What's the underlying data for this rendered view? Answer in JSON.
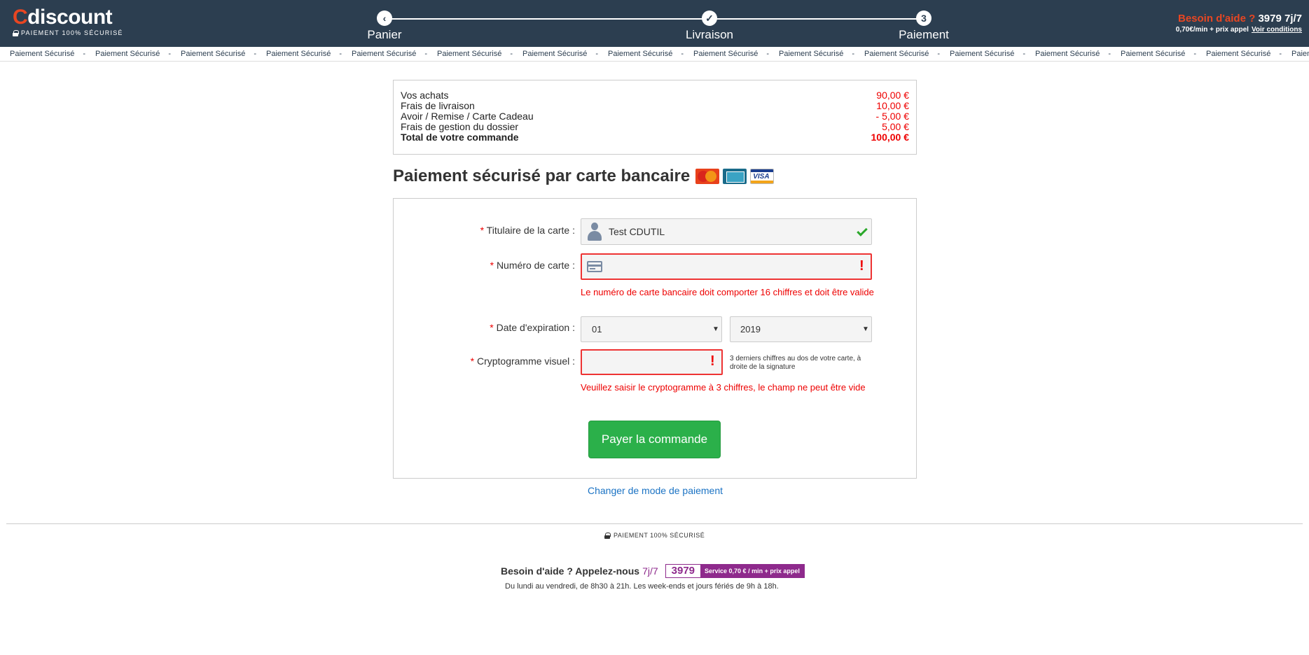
{
  "header": {
    "logo_c": "C",
    "logo_rest": "discount",
    "logo_sub": "PAIEMENT 100% SÉCURISÉ",
    "steps": [
      {
        "icon": "‹",
        "label": "Panier"
      },
      {
        "icon": "✓",
        "label": "Livraison"
      },
      {
        "icon": "3",
        "label": "Paiement"
      }
    ],
    "help_question": "Besoin d'aide ?",
    "help_number": "3979 7j/7",
    "help_price": "0,70€/min + prix appel",
    "help_conditions": "Voir conditions"
  },
  "ticker": {
    "item": "Paiement Sécurisé",
    "separator": "-",
    "last_partial": "Paiement S"
  },
  "summary": {
    "rows": [
      {
        "label": "Vos achats",
        "value": "90,00 €"
      },
      {
        "label": "Frais de livraison",
        "value": "10,00 €"
      },
      {
        "label": "Avoir / Remise / Carte Cadeau",
        "value": "- 5,00 €"
      },
      {
        "label": "Frais de gestion du dossier",
        "value": "5,00 €"
      }
    ],
    "total_label": "Total de votre commande",
    "total_value": "100,00 €"
  },
  "payment": {
    "title": "Paiement sécurisé par carte bancaire",
    "card_logos": [
      "mastercard-icon",
      "cb-icon",
      "visa-icon"
    ],
    "visa_text": "VISA",
    "required_mark": "*",
    "holder_label": "Titulaire de la carte :",
    "holder_value": "Test CDUTIL",
    "number_label": "Numéro de carte :",
    "number_value": "",
    "number_error": "Le numéro de carte bancaire doit comporter 16 chiffres et doit être valide",
    "expiry_label": "Date d'expiration :",
    "expiry_month": "01",
    "expiry_year": "2019",
    "cvv_label": "Cryptogramme visuel :",
    "cvv_value": "",
    "cvv_hint": "3 derniers chiffres au dos de votre carte, à droite de la signature",
    "cvv_error": "Veuillez saisir le cryptogramme à 3 chiffres, le champ ne peut être vide",
    "error_mark": "!",
    "pay_button": "Payer la commande",
    "change_link": "Changer de mode de paiement"
  },
  "footer": {
    "secure": "PAIEMENT 100% SÉCURISÉ",
    "help": "Besoin d'aide ? Appelez-nous",
    "days": "7j/7",
    "phone": "3979",
    "service": "Service  0,70 € / min  + prix appel",
    "hours": "Du lundi au vendredi, de 8h30 à 21h. Les week-ends et jours fériés de 9h à 18h."
  },
  "colors": {
    "header_bg": "#2c3e50",
    "accent_orange": "#e84622",
    "error_red": "#e00000",
    "pay_green": "#2bb04a",
    "link_blue": "#1b73c4",
    "phone_purple": "#8e2a8c"
  }
}
